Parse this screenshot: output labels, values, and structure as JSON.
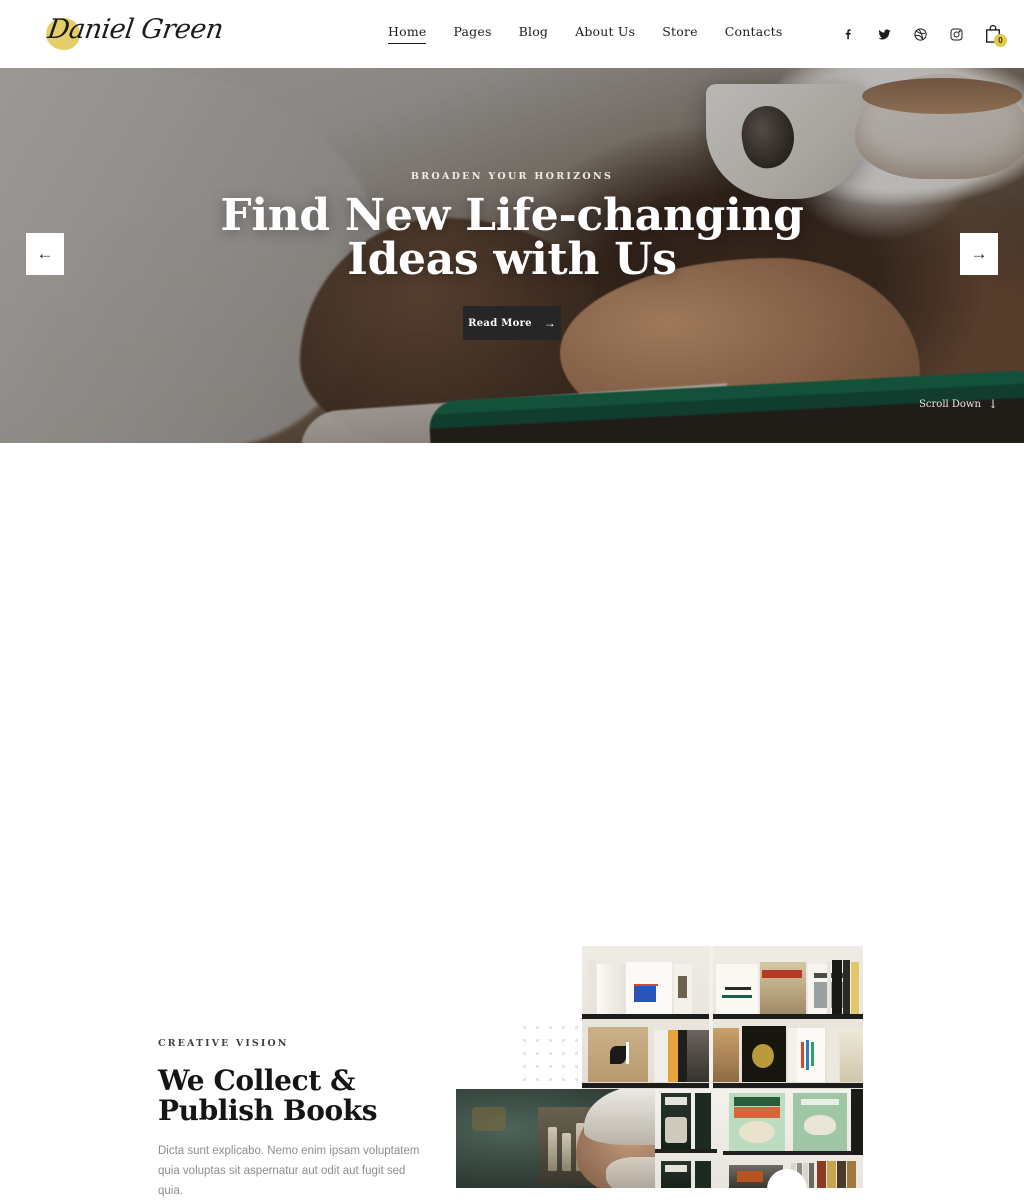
{
  "header": {
    "logo_text": "Daniel Green",
    "logo_blob_color": "#e3ce68",
    "nav": [
      {
        "label": "Home",
        "active": true
      },
      {
        "label": "Pages",
        "active": false
      },
      {
        "label": "Blog",
        "active": false
      },
      {
        "label": "About Us",
        "active": false
      },
      {
        "label": "Store",
        "active": false
      },
      {
        "label": "Contacts",
        "active": false
      }
    ],
    "social": [
      {
        "name": "facebook-icon",
        "glyph": "f"
      },
      {
        "name": "twitter-icon",
        "glyph": "t"
      },
      {
        "name": "dribbble-icon",
        "glyph": "d"
      },
      {
        "name": "instagram-icon",
        "glyph": "i"
      }
    ],
    "cart": {
      "name": "shopping-bag-icon",
      "count": "0",
      "badge_color": "#e3c84f"
    }
  },
  "hero": {
    "eyebrow": "BROADEN YOUR HORIZONS",
    "title_line1": "Find New Life-changing",
    "title_line2": "Ideas with Us",
    "cta_label": "Read More",
    "cta_arrow": "→",
    "cta_bg": "#262626",
    "prev_arrow": "←",
    "next_arrow": "→",
    "scroll_label": "Scroll Down",
    "scroll_arrow": "↓"
  },
  "about": {
    "eyebrow": "CREATIVE VISION",
    "title_line1": "We Collect &",
    "title_line2": "Publish Books",
    "body": "Dicta sunt explicabo. Nemo enim ipsam voluptatem quia voluptas sit aspernatur aut odit aut fugit sed quia.",
    "image_1_alt": "bookshelf-with-design-books",
    "image_2_alt": "elderly-man-and-cookbook-shelf"
  }
}
